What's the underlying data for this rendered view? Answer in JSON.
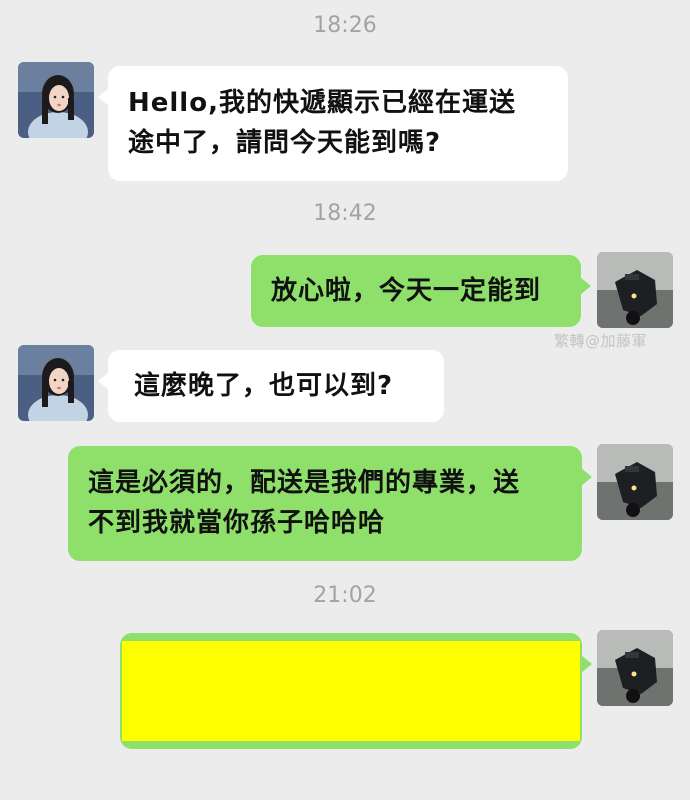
{
  "timestamps": [
    "18:26",
    "18:42",
    "21:02"
  ],
  "messages": [
    {
      "sender": "other",
      "lines": [
        "Hello,我的快遞顯示已經在運送",
        "途中了，請問今天能到嗎?"
      ]
    },
    {
      "sender": "me",
      "lines": [
        "放心啦，今天一定能到"
      ]
    },
    {
      "sender": "other",
      "lines": [
        "這麼晚了，也可以到?"
      ]
    },
    {
      "sender": "me",
      "lines": [
        "這是必須的，配送是我們的專業，送",
        "不到我就當你孫子哈哈哈"
      ]
    },
    {
      "sender": "me",
      "lines": [],
      "redacted": true,
      "redaction_color": "#ffff00"
    }
  ],
  "watermark": "繁轉@加藤軍",
  "colors": {
    "background": "#ececec",
    "incoming_bubble": "#ffffff",
    "outgoing_bubble": "#8ee06a",
    "timestamp_text": "#a3a3a3",
    "redaction": "#ffff00"
  },
  "icons": {
    "other_avatar": "girl-avatar",
    "my_avatar": "motorcycle-avatar"
  }
}
